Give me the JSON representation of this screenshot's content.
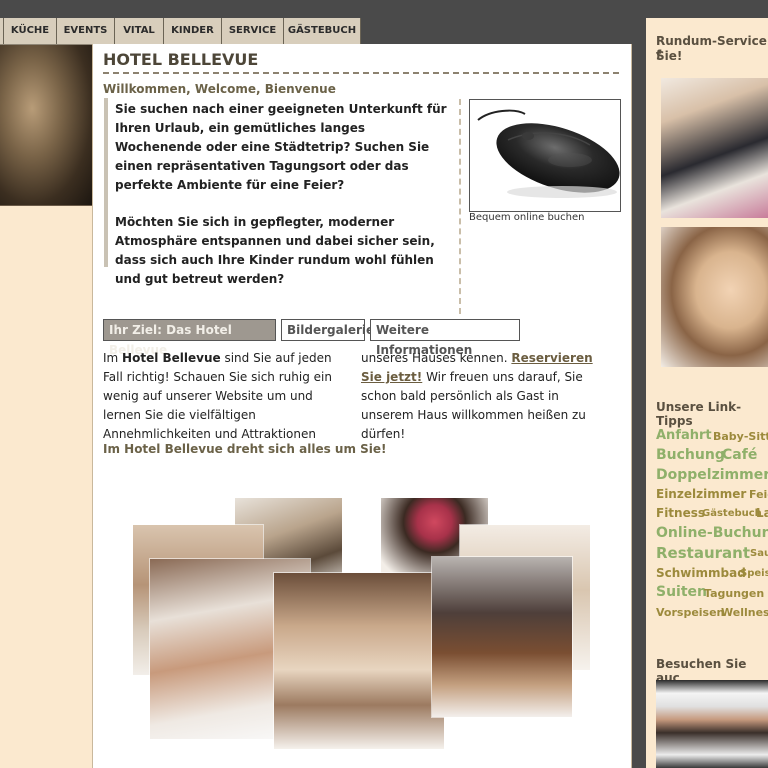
{
  "nav": {
    "items": [
      "KÜCHE",
      "EVENTS",
      "VITAL",
      "KINDER",
      "SERVICE",
      "GÄSTEBUCH"
    ]
  },
  "main": {
    "title": "HOTEL BELLEVUE",
    "welcome": "Willkommen, Welcome, Bienvenue",
    "intro_p1": "Sie suchen nach einer geeigneten Unterkunft für Ihren Urlaub, ein gemütliches langes Wochenende oder eine Städtetrip? Suchen Sie einen repräsentativen Tagungsort oder das perfekte Ambiente für eine Feier?",
    "intro_p2": "Möchten Sie sich in gepflegter, moderner Atmosphäre entspannen und dabei sicher sein, dass sich auch Ihre Kinder rundum wohl fühlen und gut betreut werden?",
    "mouse_caption": "Bequem online buchen",
    "tabs": [
      "Ihr Ziel: Das Hotel Bellevue",
      "Bildergalerie",
      "Weitere Informationen"
    ],
    "body_left_pre": "Im ",
    "body_left_bold": "Hotel Bellevue",
    "body_left_post": " sind Sie auf jeden Fall richtig! Schauen Sie sich ruhig ein wenig auf unserer Website um und lernen Sie die vielfältigen Annehmlichkeiten und Attraktionen",
    "body_right_pre": "unseres Hauses kennen. ",
    "body_right_link": "Reservieren Sie jetzt!",
    "body_right_post": " Wir freuen uns darauf, Sie schon bald persönlich als Gast in unserem Haus willkommen heißen zu dürfen!",
    "tagline": "Im Hotel Bellevue dreht sich alles um Sie!"
  },
  "right": {
    "heading1": "Rundum-Service f",
    "heading1b": "Sie!",
    "heading2": "Unsere Link-Tipps",
    "heading3": "Besuchen Sie auc",
    "tags": [
      [
        "Anfahrt",
        "Baby-Sitte"
      ],
      [
        "Buchung",
        "Café"
      ],
      [
        "Doppelzimmer"
      ],
      [
        "Einzelzimmer",
        "Feie"
      ],
      [
        "Fitness",
        "Gästebuch",
        "La"
      ],
      [
        "Online-Buchung"
      ],
      [
        "Restaurant",
        "Sau"
      ],
      [
        "Schwimmbad",
        "Speis"
      ],
      [
        "Suiten",
        "Tagungen"
      ],
      [
        "Vorspeisen",
        "Wellness"
      ]
    ]
  },
  "colors": {
    "background_dark": "#4a4a4a",
    "column_beige": "#fbe9cf",
    "nav_bg": "#d8cebc",
    "link_brown": "#6b5d40",
    "tag_gold": "#9c8a3c",
    "tag_green": "#8fb06a"
  }
}
